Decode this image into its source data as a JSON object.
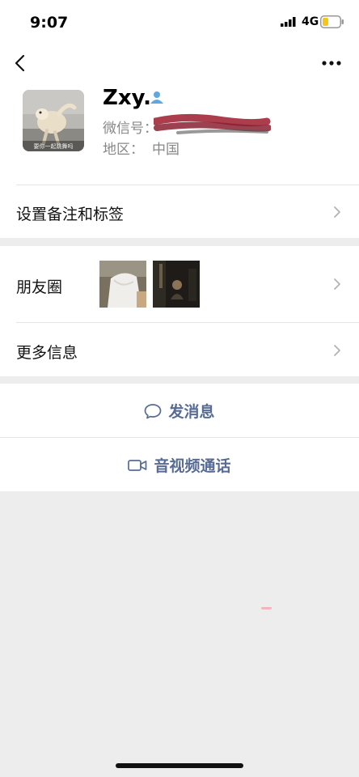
{
  "status_bar": {
    "time": "9:07",
    "network": "4G",
    "signal_icon": "signal-bars-icon",
    "battery_icon": "battery-low-icon",
    "battery_color": "#f5c518"
  },
  "nav": {
    "back_icon": "chevron-left-icon",
    "more_icon": "more-dots-icon"
  },
  "profile": {
    "name": "Zxy.",
    "wechat_id_label": "微信号：",
    "region_label": "地区：",
    "region_value": "中国",
    "badge_icon": "person-icon",
    "badge_color": "#5fa8e0",
    "avatar_caption": "要你一起跳舞吗"
  },
  "menu": {
    "remark_tags": "设置备注和标签",
    "moments": "朋友圈",
    "more_info": "更多信息"
  },
  "actions": {
    "send_message": "发消息",
    "av_call": "音视频通话",
    "accent_color": "#576b95"
  },
  "colors": {
    "background": "#ededed",
    "card": "#ffffff",
    "redaction": "#a3283a"
  }
}
